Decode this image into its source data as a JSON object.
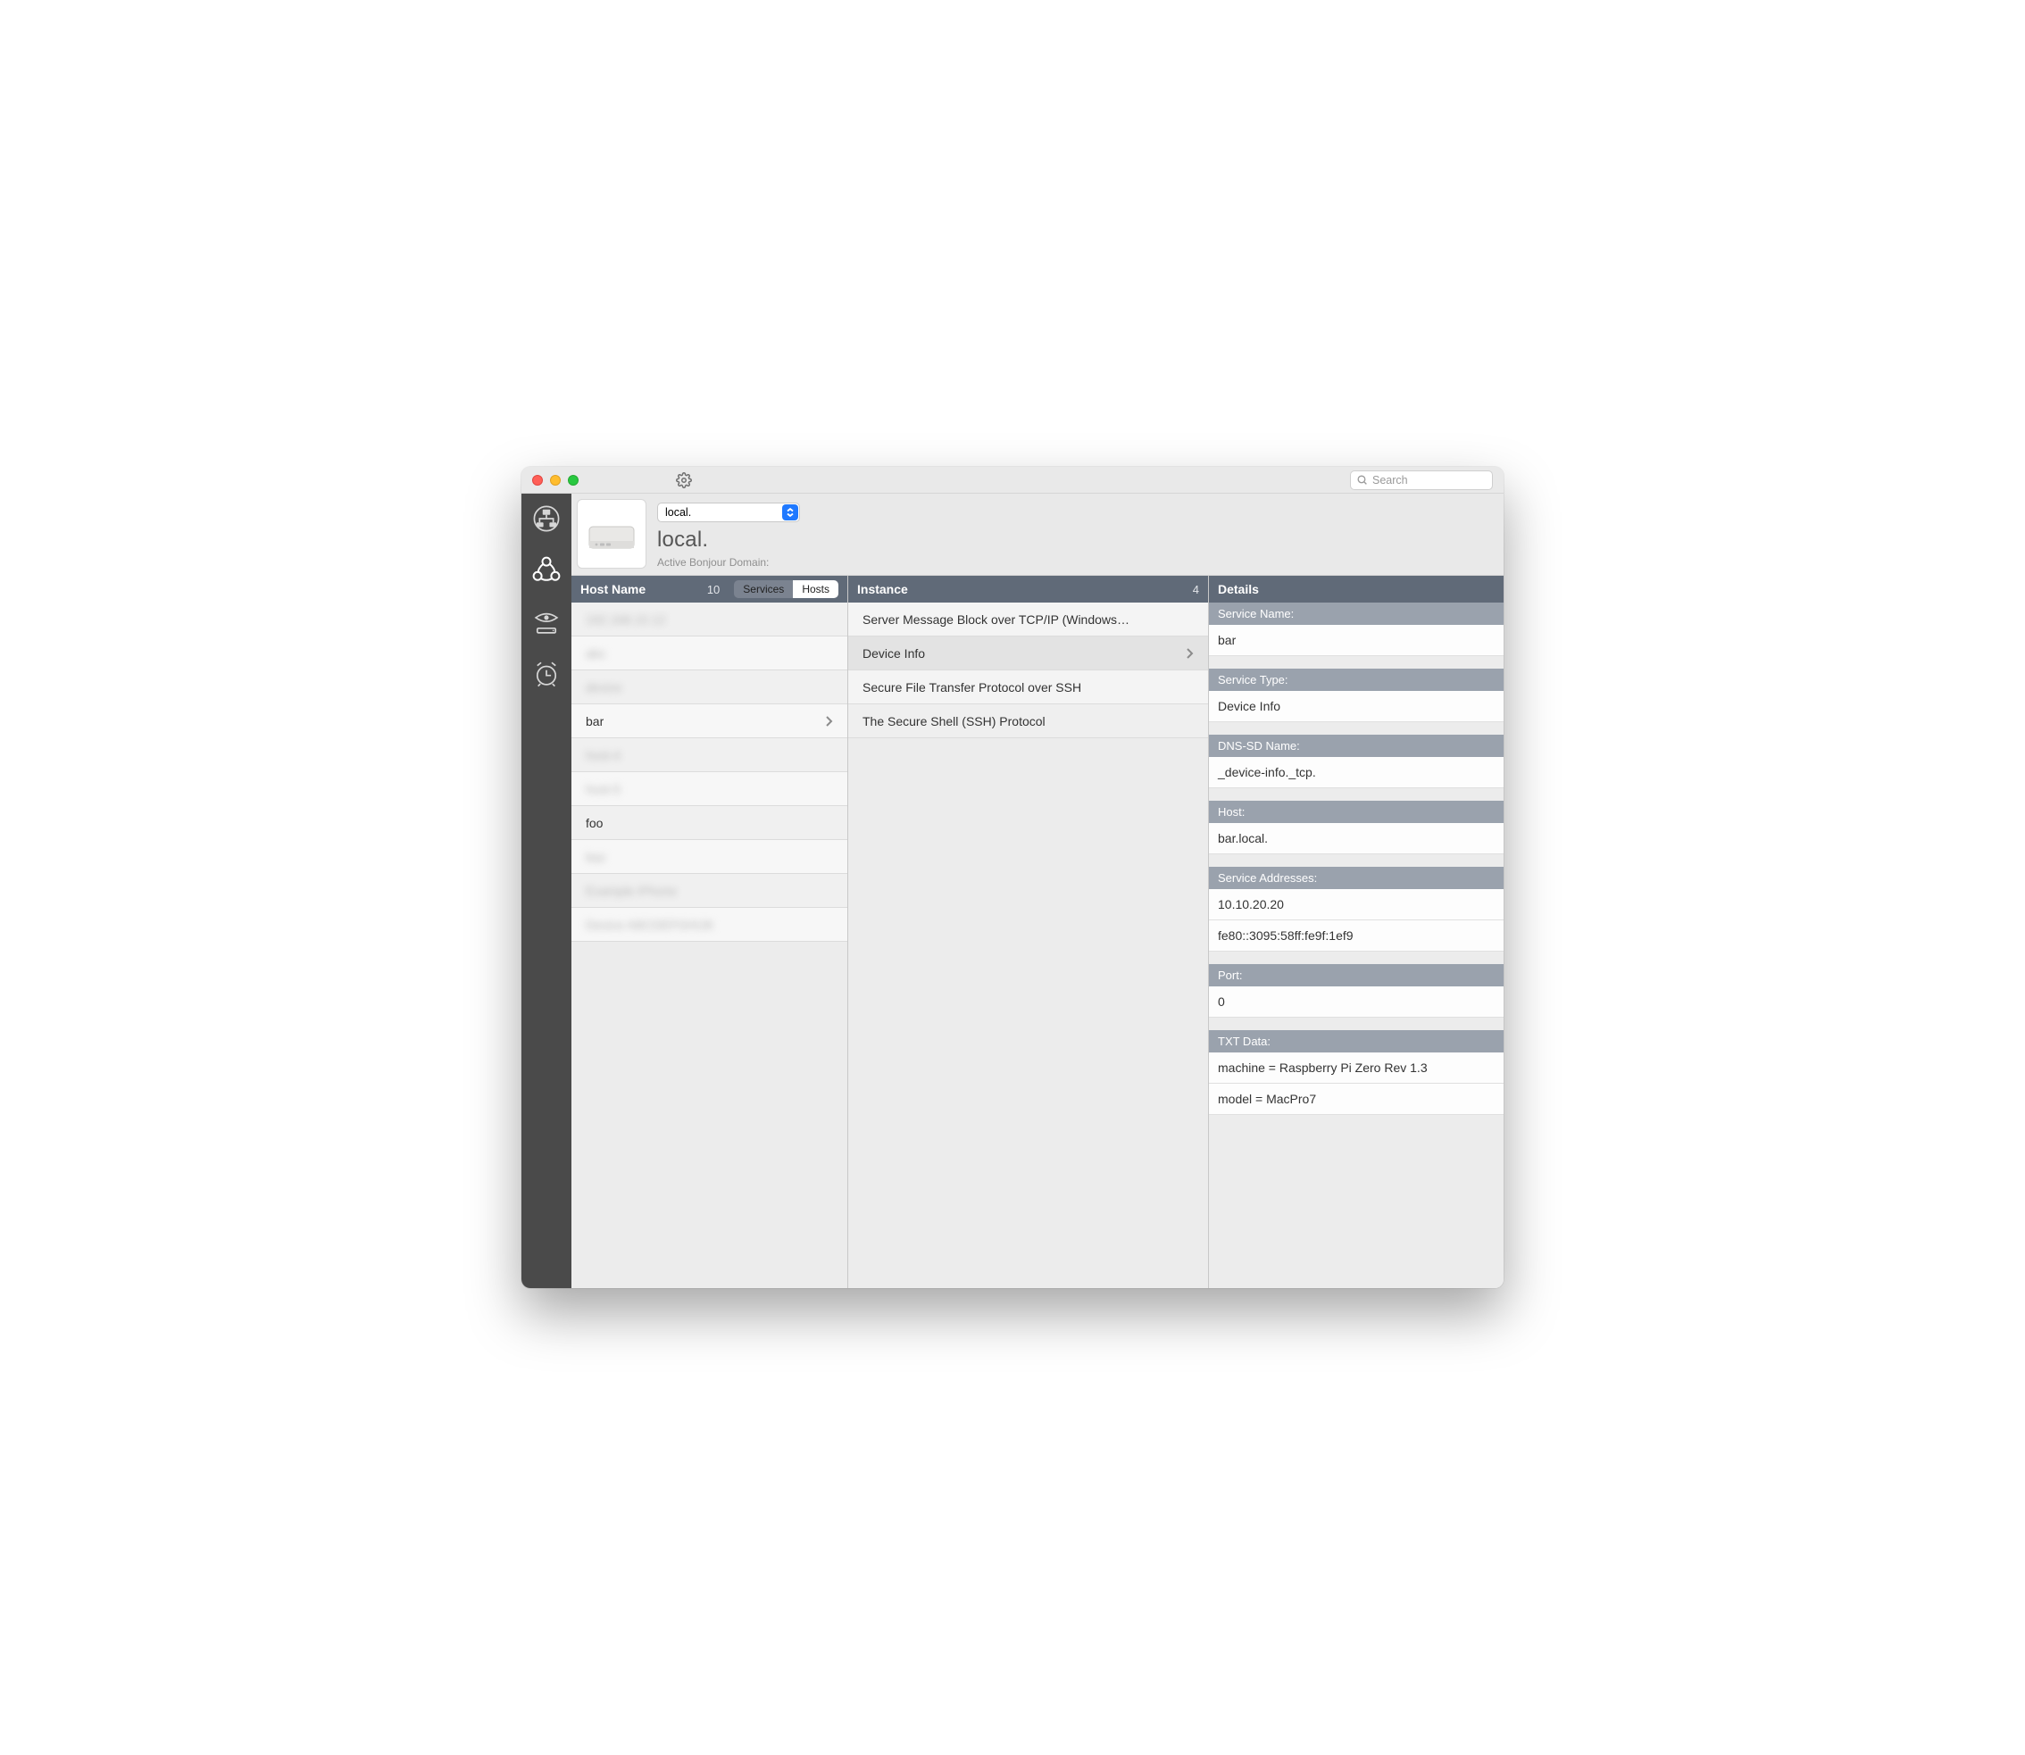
{
  "toolbar": {
    "search_placeholder": "Search"
  },
  "domain": {
    "select_value": "local.",
    "title": "local.",
    "subtitle": "Active Bonjour Domain:"
  },
  "columns": {
    "hosts": {
      "title": "Host Name",
      "count": "10",
      "segment": {
        "services": "Services",
        "hosts": "Hosts",
        "active": "hosts"
      }
    },
    "instance": {
      "title": "Instance",
      "count": "4"
    },
    "details": {
      "title": "Details"
    }
  },
  "hosts": [
    {
      "label": "192.168.10.12",
      "blurred": true
    },
    {
      "label": "abc",
      "blurred": true
    },
    {
      "label": "device",
      "blurred": true
    },
    {
      "label": "bar",
      "blurred": false,
      "selected": true,
      "chevron": true
    },
    {
      "label": "host-4",
      "blurred": true
    },
    {
      "label": "host-5",
      "blurred": true
    },
    {
      "label": "foo",
      "blurred": false
    },
    {
      "label": "baz",
      "blurred": true
    },
    {
      "label": "Example iPhone",
      "blurred": true
    },
    {
      "label": "Device ABCDEFGHIJK",
      "blurred": true
    }
  ],
  "instances": [
    {
      "label": "Server Message Block over TCP/IP (Windows…"
    },
    {
      "label": "Device Info",
      "selected": true,
      "chevron": true
    },
    {
      "label": "Secure File Transfer Protocol over SSH"
    },
    {
      "label": "The Secure Shell (SSH) Protocol"
    }
  ],
  "details": {
    "service_name": {
      "label": "Service Name:",
      "value": "bar"
    },
    "service_type": {
      "label": "Service Type:",
      "value": "Device Info"
    },
    "dns_sd_name": {
      "label": "DNS-SD Name:",
      "value": "_device-info._tcp."
    },
    "host": {
      "label": "Host:",
      "value": "bar.local."
    },
    "service_addresses": {
      "label": "Service Addresses:",
      "values": [
        "10.10.20.20",
        "fe80::3095:58ff:fe9f:1ef9"
      ]
    },
    "port": {
      "label": "Port:",
      "value": "0"
    },
    "txt_data": {
      "label": "TXT Data:",
      "values": [
        "machine = Raspberry Pi Zero Rev 1.3",
        "model = MacPro7"
      ]
    }
  }
}
